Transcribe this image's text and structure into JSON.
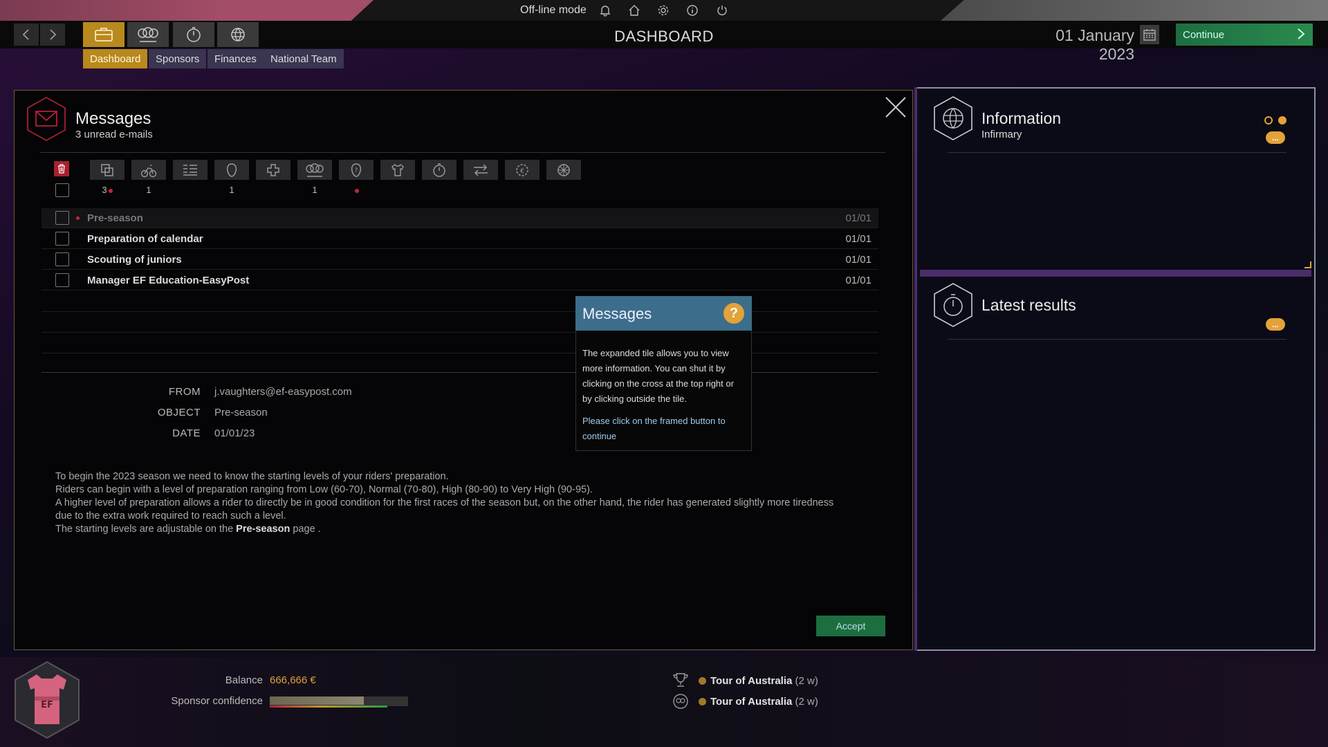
{
  "topbar": {
    "mode_label": "Off-line mode",
    "icons": [
      "bell-icon",
      "home-icon",
      "gear-icon",
      "info-icon",
      "power-icon"
    ]
  },
  "nav": {
    "page_title": "DASHBOARD",
    "date": "01 January 2023",
    "continue_label": "Continue",
    "main_tabs": [
      "briefcase-icon",
      "team-icon",
      "stopwatch-icon",
      "globe-icon"
    ],
    "sub_tabs": [
      "Dashboard",
      "Sponsors",
      "Finances",
      "National Team"
    ],
    "active_sub_tab": "Dashboard"
  },
  "messages": {
    "title": "Messages",
    "subtitle": "3 unread e-mails",
    "filters": [
      {
        "icon": "copy-icon",
        "count": "3",
        "dot": true
      },
      {
        "icon": "cyclist-icon",
        "count": "1",
        "dot": false
      },
      {
        "icon": "list-icon",
        "count": "",
        "dot": false
      },
      {
        "icon": "head-icon",
        "count": "1",
        "dot": false
      },
      {
        "icon": "medical-cross-icon",
        "count": "",
        "dot": false
      },
      {
        "icon": "team-icon",
        "count": "1",
        "dot": false
      },
      {
        "icon": "scout-icon",
        "count": "",
        "dot": true
      },
      {
        "icon": "jersey-icon",
        "count": "",
        "dot": false
      },
      {
        "icon": "stopwatch-icon",
        "count": "",
        "dot": false
      },
      {
        "icon": "transfer-icon",
        "count": "",
        "dot": false
      },
      {
        "icon": "sponsor-gear-icon",
        "count": "",
        "dot": false
      },
      {
        "icon": "wheel-icon",
        "count": "",
        "dot": false
      }
    ],
    "rows": [
      {
        "subject": "Pre-season",
        "date": "01/01",
        "read": true,
        "selected": true
      },
      {
        "subject": "Preparation of calendar",
        "date": "01/01",
        "read": false,
        "selected": false
      },
      {
        "subject": "Scouting of juniors",
        "date": "01/01",
        "read": false,
        "selected": false
      },
      {
        "subject": "Manager EF Education-EasyPost",
        "date": "01/01",
        "read": false,
        "selected": false
      }
    ],
    "detail": {
      "from_label": "FROM",
      "from_value": "j.vaughters@ef-easypost.com",
      "object_label": "OBJECT",
      "object_value": "Pre-season",
      "date_label": "DATE",
      "date_value": "01/01/23",
      "body_lines": [
        "To begin the 2023 season we need to know the starting levels of your riders' preparation.",
        "Riders can begin with a level of preparation ranging from Low (60-70), Normal (70-80), High (80-90) to Very High (90-95).",
        "A higher level of preparation allows a rider to directly be in good condition for the first races of the season but, on the other hand, the rider has generated slightly more tiredness",
        "due to the extra work required to reach such a level."
      ],
      "last_line_prefix": "The starting levels are adjustable on the ",
      "last_line_link": "Pre-season",
      "last_line_suffix": " page ."
    },
    "accept_label": "Accept"
  },
  "tutorial": {
    "title": "Messages",
    "help_glyph": "?",
    "body": "The expanded tile allows you to view more information. You can shut it by clicking on the cross at the top right or by clicking outside the tile.",
    "cta": "Please click on the framed button to continue"
  },
  "information": {
    "title": "Information",
    "subtitle": "Infirmary",
    "more_label": "..."
  },
  "latest_results": {
    "title": "Latest results",
    "more_label": "..."
  },
  "footer": {
    "balance_label": "Balance",
    "balance_value": "666,666 €",
    "confidence_label": "Sponsor confidence",
    "confidence_level": 0.68,
    "races": [
      {
        "icon": "trophy-icon",
        "name": "Tour of Australia",
        "when": "(2 w)"
      },
      {
        "icon": "team-icon",
        "name": "Tour of Australia",
        "when": "(2 w)"
      }
    ]
  },
  "colors": {
    "accent": "#e3a23a",
    "active_tab": "#b8891c",
    "continue_green": "#1d6e3f",
    "unread_red": "#c8243a",
    "tutorial_header": "#3c6d8a"
  }
}
